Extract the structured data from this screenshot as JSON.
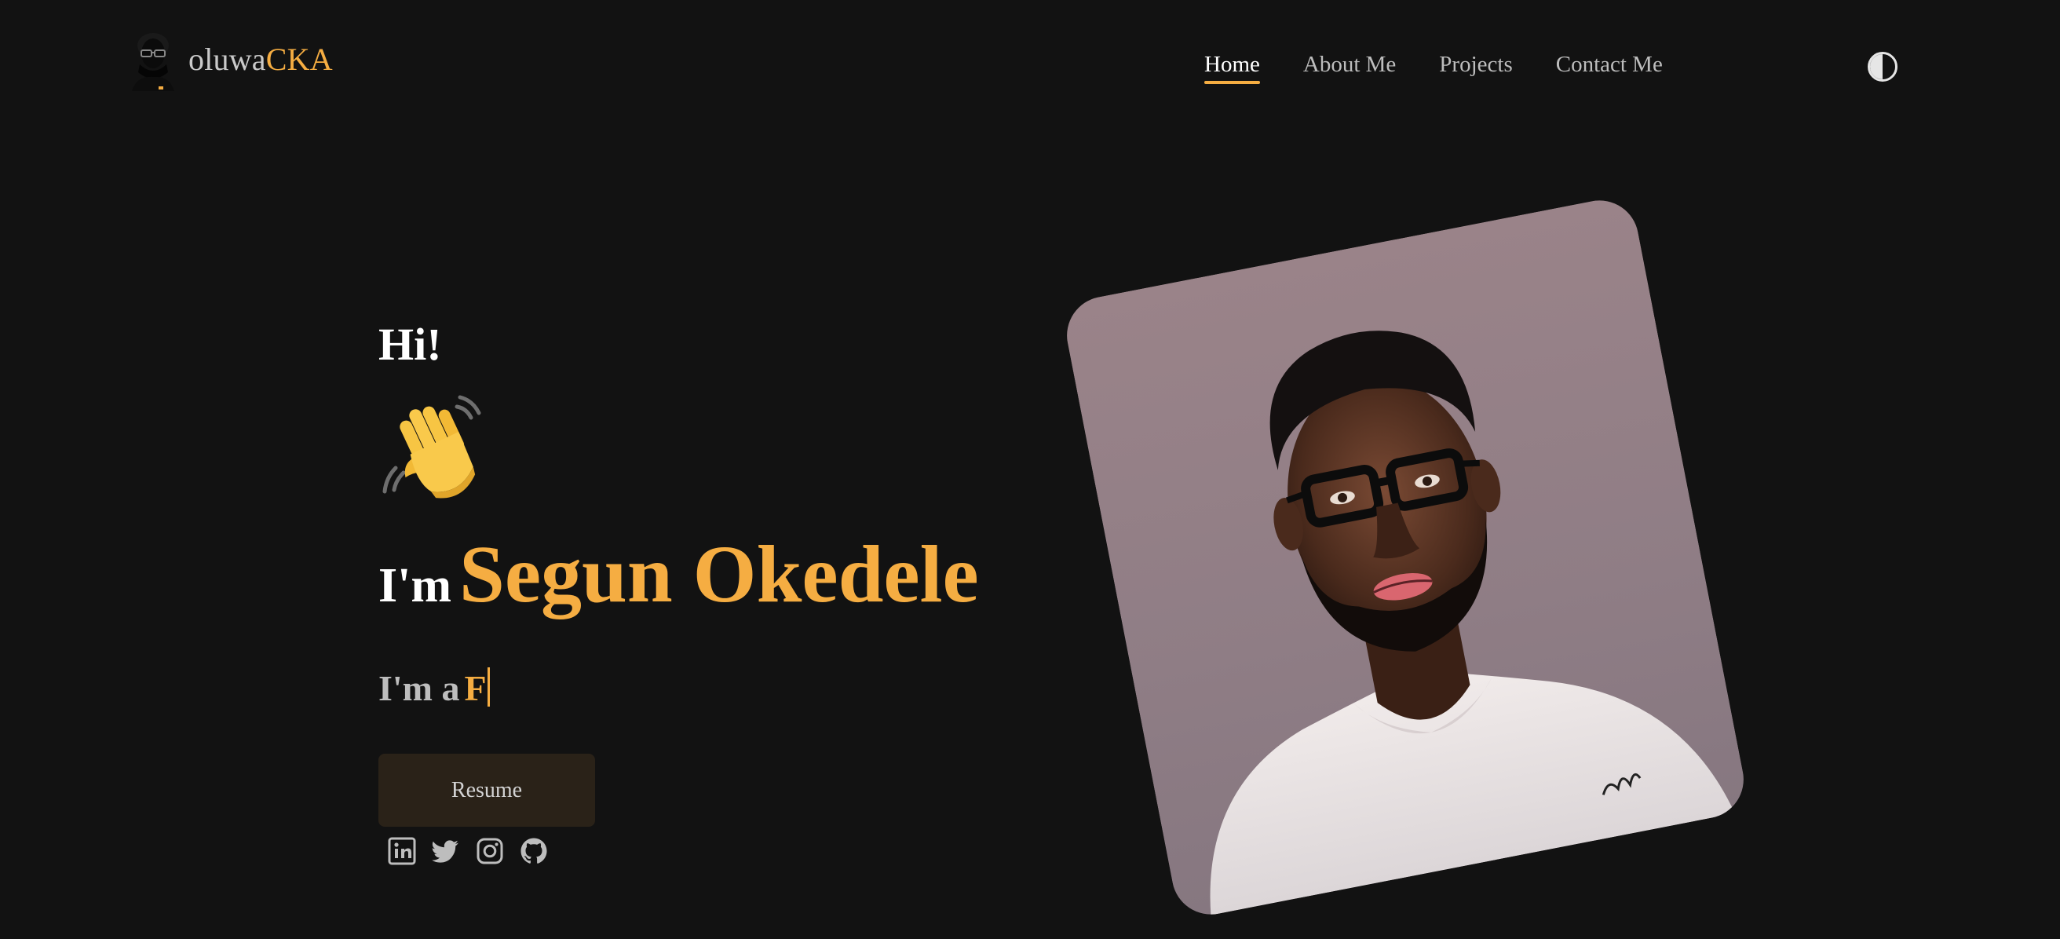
{
  "header": {
    "logo_text_plain": "oluwa",
    "logo_text_accent": "CKA",
    "logo_icon": "avatar-portrait-icon",
    "nav": [
      {
        "label": "Home",
        "active": true
      },
      {
        "label": "About Me",
        "active": false
      },
      {
        "label": "Projects",
        "active": false
      },
      {
        "label": "Contact Me",
        "active": false
      }
    ],
    "theme_toggle_icon": "contrast-half-circle-icon"
  },
  "hero": {
    "greeting": "Hi!",
    "wave_icon": "waving-hand-icon",
    "im_label": "I'm",
    "name": "Segun Okedele",
    "role_prefix": "I'm a",
    "role_typed": "F",
    "resume_label": "Resume",
    "socials": [
      {
        "name": "linkedin",
        "icon": "linkedin-icon"
      },
      {
        "name": "twitter",
        "icon": "twitter-icon"
      },
      {
        "name": "instagram",
        "icon": "instagram-icon"
      },
      {
        "name": "github",
        "icon": "github-icon"
      }
    ],
    "portrait": "illustrated-portrait"
  },
  "colors": {
    "background": "#121212",
    "accent": "#f5ad42",
    "text_primary": "#ffffff",
    "text_muted": "#bdbdbd",
    "button_bg": "#2a2218"
  }
}
